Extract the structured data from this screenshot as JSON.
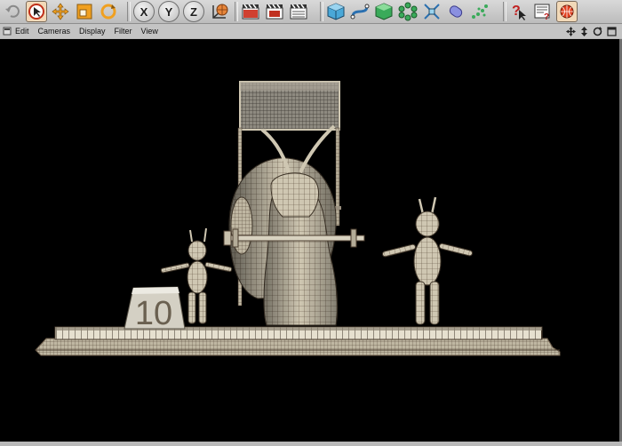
{
  "menu": {
    "items": [
      {
        "label": "Edit"
      },
      {
        "label": "Cameras"
      },
      {
        "label": "Display"
      },
      {
        "label": "Filter"
      },
      {
        "label": "View"
      }
    ]
  },
  "toolbar": {
    "axis_buttons": [
      {
        "label": "X"
      },
      {
        "label": "Y"
      },
      {
        "label": "Z"
      }
    ]
  },
  "scene": {
    "block_number": "10"
  },
  "colors": {
    "viewport_bg": "#000000",
    "model_surface": "#cfc7b2",
    "wire": "#5a4a3a",
    "toolbar_bg": "#c9c9c9"
  }
}
